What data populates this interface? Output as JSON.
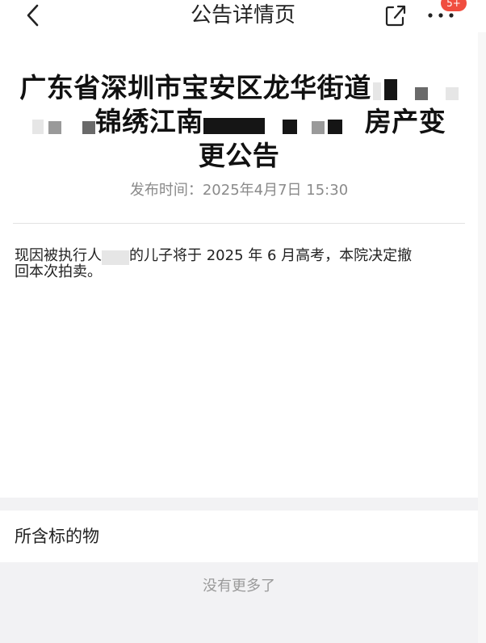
{
  "nav": {
    "title": "公告详情页",
    "badge": "5+",
    "back_icon": "chevron-left-icon",
    "share_icon": "share-icon",
    "more_icon": "more-dots-icon"
  },
  "article": {
    "title_line1": "广东省深圳市宝安区龙华街道",
    "title_line2_a": "锦绣江南",
    "title_line2_b": "房产变",
    "title_line3": "更公告",
    "publish_time": "发布时间：2025年4月7日 15:30",
    "body_part1": "现因被执行人",
    "body_part2": "的儿子将于 2025 年 6 月高考，本院决定撤",
    "body_part3": "回本次拍卖。"
  },
  "section": {
    "title": "所含标的物"
  },
  "footer": {
    "no_more": "没有更多了"
  },
  "colors": {
    "badge": "#f04d3f",
    "publish_text": "#8a8a8a",
    "background": "#f2f2f4"
  }
}
